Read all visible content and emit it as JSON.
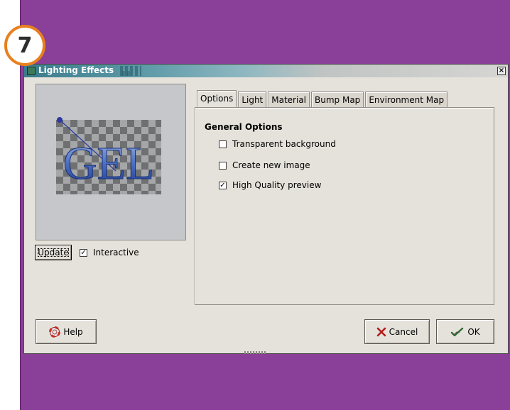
{
  "step_badge": "7",
  "window": {
    "title": "Lighting Effects",
    "close_glyph": "×"
  },
  "preview": {
    "image_text": "GEL",
    "update_label": "Update",
    "interactive_label": "Interactive",
    "interactive_checked": true
  },
  "tabs": [
    {
      "label": "Options",
      "active": true
    },
    {
      "label": "Light",
      "active": false
    },
    {
      "label": "Material",
      "active": false
    },
    {
      "label": "Bump Map",
      "active": false
    },
    {
      "label": "Environment Map",
      "active": false
    }
  ],
  "general_options": {
    "title": "General Options",
    "transparent_background": {
      "label": "Transparent background",
      "checked": false
    },
    "create_new_image": {
      "label": "Create new image",
      "checked": false
    },
    "high_quality_preview": {
      "label": "High Quality preview",
      "checked": true
    }
  },
  "buttons": {
    "help": "Help",
    "cancel": "Cancel",
    "ok": "OK"
  },
  "icons": {
    "window": "window-icon",
    "help": "lifebuoy-icon",
    "cancel": "x-mark-icon",
    "ok": "checkmark-hand-icon"
  },
  "colors": {
    "background": "#8a3f98",
    "badge_ring": "#e8801e",
    "dialog": "#e5e2db",
    "title_gradient": "#3a7c8c"
  }
}
